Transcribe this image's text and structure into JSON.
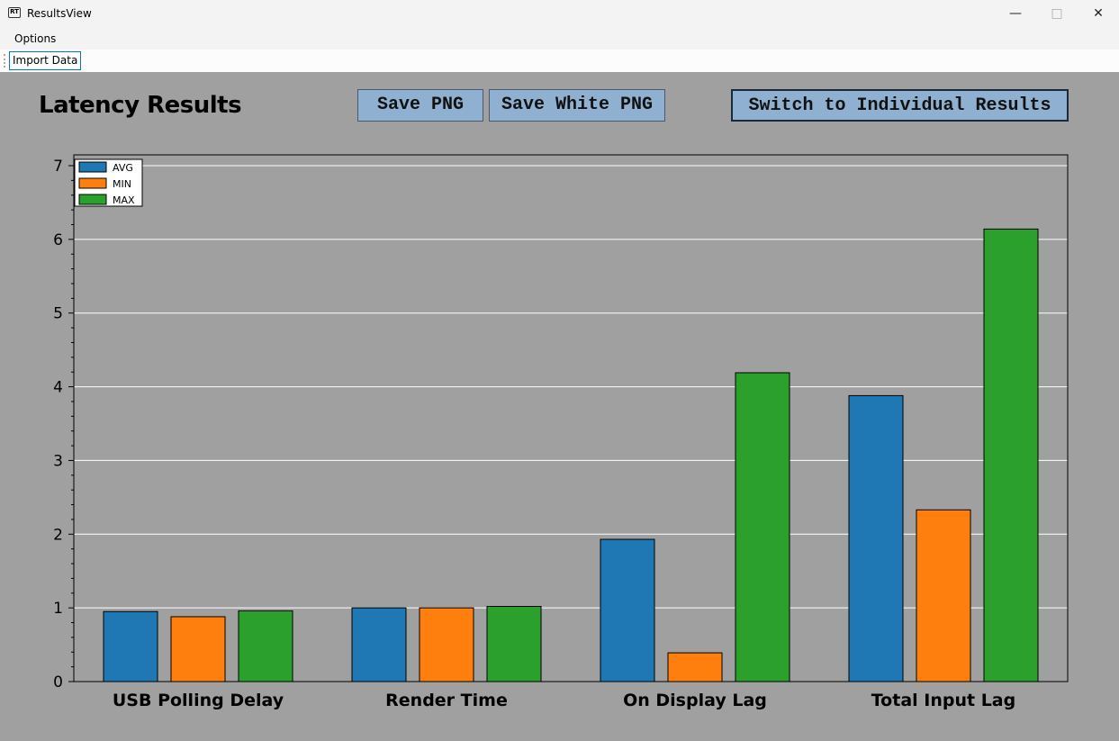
{
  "window": {
    "title": "ResultsView",
    "icon": "rt-monitor-icon"
  },
  "menu": {
    "options": "Options"
  },
  "toolbar": {
    "import_data": "Import Data"
  },
  "header": {
    "title": "Latency Results",
    "save_png": "Save PNG",
    "save_white_png": "Save White PNG",
    "switch": "Switch to Individual Results"
  },
  "chart_data": {
    "type": "bar",
    "categories": [
      "USB Polling Delay",
      "Render Time",
      "On Display Lag",
      "Total Input Lag"
    ],
    "series": [
      {
        "name": "AVG",
        "color": "#1f77b4",
        "values": [
          0.95,
          1.0,
          1.93,
          3.88
        ]
      },
      {
        "name": "MIN",
        "color": "#ff7f0e",
        "values": [
          0.88,
          1.0,
          0.39,
          2.33
        ]
      },
      {
        "name": "MAX",
        "color": "#2ca02c",
        "values": [
          0.96,
          1.02,
          4.19,
          6.14
        ]
      }
    ],
    "ylim": [
      0,
      7
    ],
    "yticks": [
      0,
      1,
      2,
      3,
      4,
      5,
      6,
      7
    ],
    "grid": true,
    "legend": "top-left"
  }
}
